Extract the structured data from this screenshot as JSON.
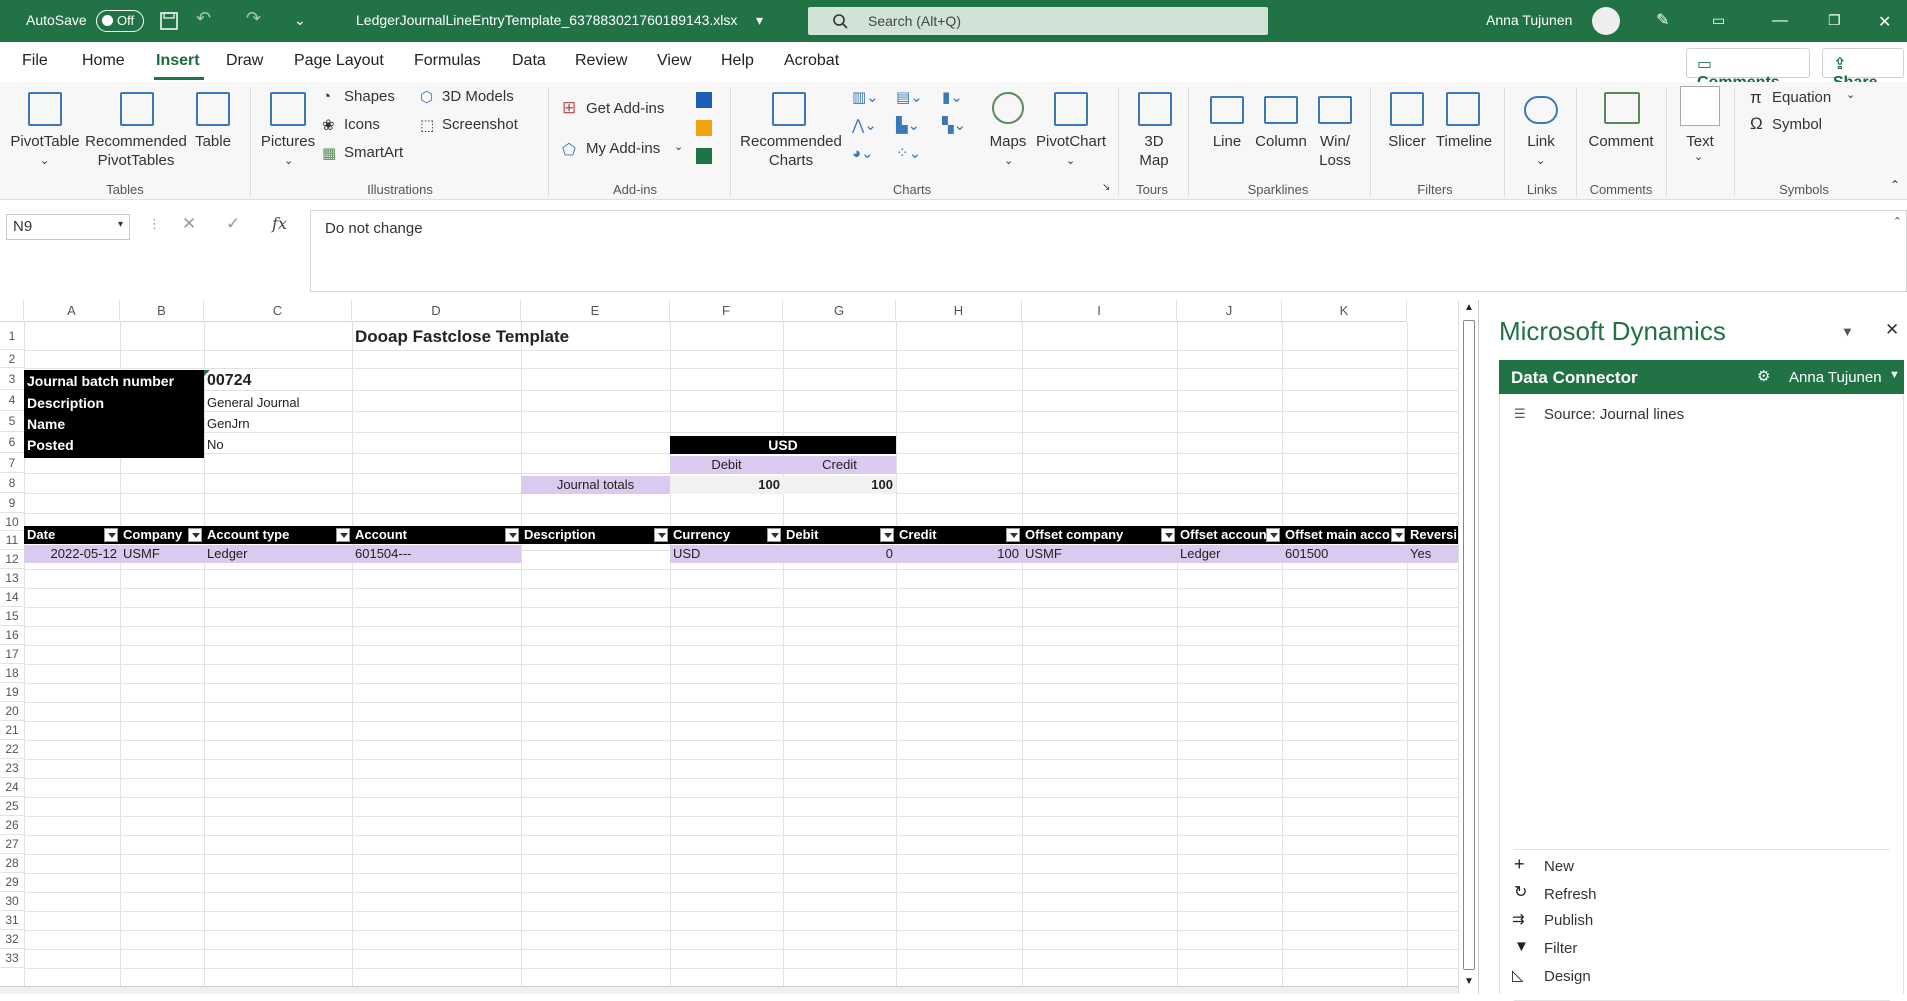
{
  "titlebar": {
    "autosave": "AutoSave",
    "autosave_state": "Off",
    "filename": "LedgerJournalLineEntryTemplate_637883021760189143.xlsx",
    "search_placeholder": "Search (Alt+Q)",
    "user": "Anna Tujunen"
  },
  "menu": {
    "items": [
      "File",
      "Home",
      "Insert",
      "Draw",
      "Page Layout",
      "Formulas",
      "Data",
      "Review",
      "View",
      "Help",
      "Acrobat"
    ],
    "comments": "Comments",
    "share": "Share"
  },
  "ribbon": {
    "tables": {
      "pivot": "PivotTable",
      "rec_pivot": "Recommended PivotTables",
      "table": "Table",
      "group": "Tables"
    },
    "illustrations": {
      "pictures": "Pictures",
      "shapes": "Shapes",
      "icons": "Icons",
      "smartart": "SmartArt",
      "models": "3D Models",
      "screenshot": "Screenshot",
      "group": "Illustrations"
    },
    "addins": {
      "get": "Get Add-ins",
      "my": "My Add-ins",
      "group": "Add-ins"
    },
    "charts": {
      "recommended": "Recommended Charts",
      "maps": "Maps",
      "pivotchart": "PivotChart",
      "group": "Charts"
    },
    "tours": {
      "map3d": "3D Map",
      "group": "Tours"
    },
    "sparklines": {
      "line": "Line",
      "column": "Column",
      "winloss": "Win/ Loss",
      "group": "Sparklines"
    },
    "filters": {
      "slicer": "Slicer",
      "timeline": "Timeline",
      "group": "Filters"
    },
    "links": {
      "link": "Link",
      "group": "Links"
    },
    "comments": {
      "comment": "Comment",
      "group": "Comments"
    },
    "text": {
      "text": "Text"
    },
    "symbols": {
      "equation": "Equation",
      "symbol": "Symbol",
      "group": "Symbols"
    }
  },
  "formula_bar": {
    "name_box": "N9",
    "fx": "fx",
    "formula": "Do not change"
  },
  "grid": {
    "columns": [
      "A",
      "B",
      "C",
      "D",
      "E",
      "F",
      "G",
      "H",
      "I",
      "J",
      "K"
    ],
    "rows": [
      "1",
      "2",
      "3",
      "4",
      "5",
      "6",
      "7",
      "8",
      "9",
      "10",
      "11",
      "12",
      "13",
      "14",
      "15",
      "16",
      "17",
      "18",
      "19",
      "20",
      "21",
      "22",
      "23",
      "24",
      "25",
      "26",
      "27",
      "28",
      "29",
      "30",
      "31",
      "32",
      "33"
    ],
    "template_title": "Dooap Fastclose Template",
    "header_labels": {
      "batch": "Journal batch number",
      "description": "Description",
      "name": "Name",
      "posted": "Posted"
    },
    "header_values": {
      "batch": "00724",
      "description": "General Journal",
      "name": "GenJrn",
      "posted": "No"
    },
    "totals": {
      "currency": "USD",
      "debit_label": "Debit",
      "credit_label": "Credit",
      "label": "Journal totals",
      "debit": "100",
      "credit": "100"
    },
    "table_headers": [
      "Date",
      "Company",
      "Account type",
      "Account",
      "Description",
      "Currency",
      "Debit",
      "Credit",
      "Offset company",
      "Offset accoun",
      "Offset main acco",
      "Reversi"
    ],
    "row": [
      "2022-05-12",
      "USMF",
      "Ledger",
      "601504---",
      "",
      "USD",
      "0",
      "100",
      "USMF",
      "Ledger",
      "601500",
      "Yes"
    ]
  },
  "pane": {
    "title": "Microsoft Dynamics",
    "connector": "Data Connector",
    "user": "Anna Tujunen",
    "source": "Source: Journal lines",
    "actions": [
      "New",
      "Refresh",
      "Publish",
      "Filter",
      "Design"
    ]
  }
}
